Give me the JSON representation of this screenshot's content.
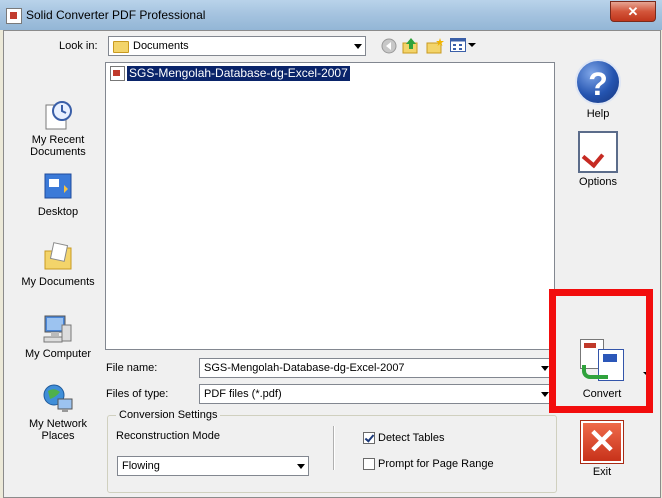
{
  "window": {
    "title": "Solid Converter PDF Professional",
    "close_glyph": "✕"
  },
  "toolbar": {
    "look_in_label": "Look in:",
    "look_in_value": "Documents",
    "icons": [
      "back-icon",
      "up-folder-icon",
      "new-folder-icon",
      "view-menu-icon"
    ]
  },
  "places": [
    {
      "label": "My Recent Documents",
      "icon": "recent-documents-icon"
    },
    {
      "label": "Desktop",
      "icon": "desktop-icon"
    },
    {
      "label": "My Documents",
      "icon": "my-documents-icon"
    },
    {
      "label": "My Computer",
      "icon": "my-computer-icon"
    },
    {
      "label": "My Network Places",
      "icon": "network-places-icon"
    }
  ],
  "files": [
    {
      "name": "SGS-Mengolah-Database-dg-Excel-2007",
      "selected": true
    }
  ],
  "form": {
    "file_name_label": "File name:",
    "file_name_value": "SGS-Mengolah-Database-dg-Excel-2007",
    "file_type_label": "Files of type:",
    "file_type_value": "PDF files (*.pdf)"
  },
  "settings": {
    "group_title": "Conversion Settings",
    "mode_label": "Reconstruction Mode",
    "mode_value": "Flowing",
    "detect_tables_label": "Detect Tables",
    "detect_tables_checked": true,
    "prompt_range_label": "Prompt for Page Range",
    "prompt_range_checked": false
  },
  "side_buttons": {
    "help": "Help",
    "help_glyph": "?",
    "options": "Options",
    "convert": "Convert",
    "exit": "Exit",
    "exit_glyph": "✕"
  },
  "colors": {
    "highlight": "#f20d0d",
    "selection": "#0a246a"
  }
}
